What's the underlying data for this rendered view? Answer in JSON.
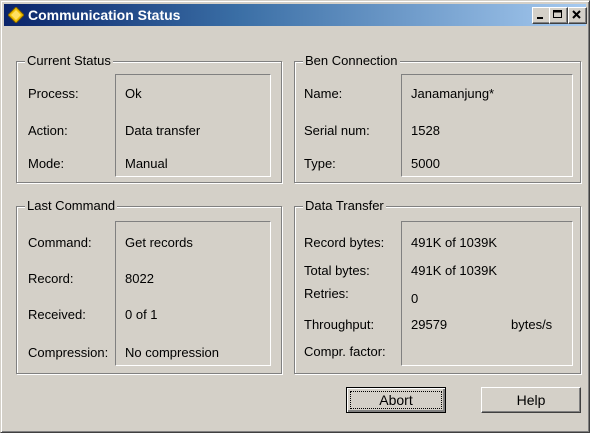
{
  "window": {
    "title": "Communication Status",
    "controls": {
      "minimize": "_",
      "maximize": "□",
      "close": "×"
    }
  },
  "current_status": {
    "legend": "Current Status",
    "process_label": "Process:",
    "process_value": "Ok",
    "action_label": "Action:",
    "action_value": "Data transfer",
    "mode_label": "Mode:",
    "mode_value": "Manual"
  },
  "ben_connection": {
    "legend": "Ben Connection",
    "name_label": "Name:",
    "name_value": "Janamanjung*",
    "serial_label": "Serial num:",
    "serial_value": "1528",
    "type_label": "Type:",
    "type_value": "5000"
  },
  "last_command": {
    "legend": "Last Command",
    "command_label": "Command:",
    "command_value": "Get records",
    "record_label": "Record:",
    "record_value": "8022",
    "received_label": "Received:",
    "received_value": "0 of 1",
    "compression_label": "Compression:",
    "compression_value": "No compression"
  },
  "data_transfer": {
    "legend": "Data Transfer",
    "record_bytes_label": "Record bytes:",
    "record_bytes_value": "491K of 1039K",
    "total_bytes_label": "Total bytes:",
    "total_bytes_value": "491K of 1039K",
    "retries_label": "Retries:",
    "retries_value": "0",
    "throughput_label": "Throughput:",
    "throughput_value": "29579",
    "throughput_unit": "bytes/s",
    "compr_factor_label": "Compr. factor:",
    "compr_factor_value": ""
  },
  "buttons": {
    "abort": "Abort",
    "help": "Help"
  },
  "icon": "diamond-app-icon",
  "colors": {
    "titlebar_start": "#0a246a",
    "titlebar_end": "#a6caf0",
    "face": "#d4d0c8"
  }
}
